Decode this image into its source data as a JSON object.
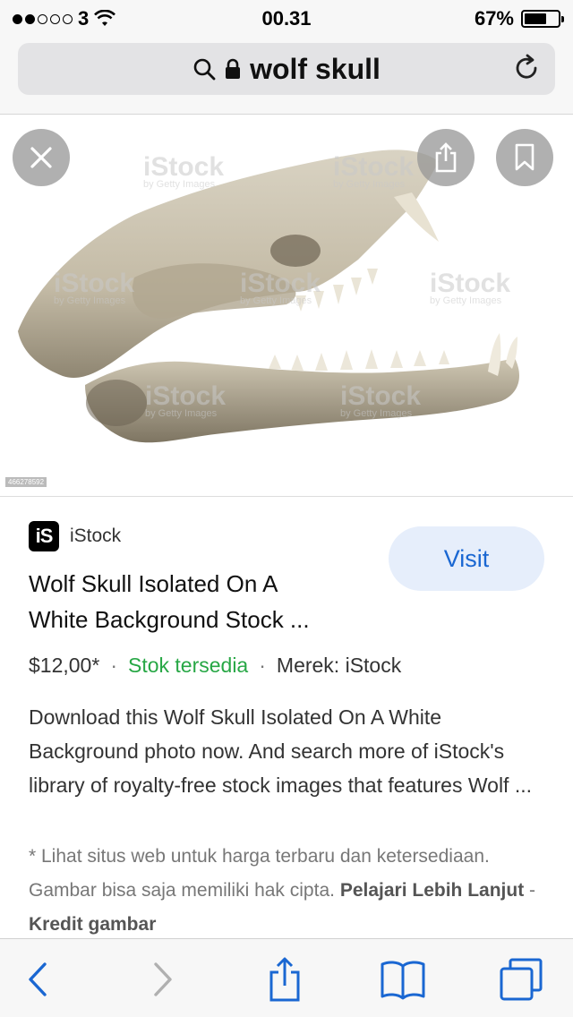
{
  "status_bar": {
    "carrier": "3",
    "time": "00.31",
    "battery_percent": "67%",
    "battery_level": 0.67
  },
  "url_bar": {
    "query": "wolf skull"
  },
  "image": {
    "watermark": "iStock",
    "watermark_sub": "by Getty Images",
    "image_id": "466278592"
  },
  "result": {
    "source_logo": "iS",
    "source": "iStock",
    "title_line1": "Wolf Skull Isolated On A",
    "title_line2": "White Background Stock ...",
    "visit_label": "Visit",
    "price": "$12,00*",
    "separator": "·",
    "availability": "Stok tersedia",
    "brand": "Merek: iStock",
    "description": "Download this Wolf Skull Isolated On A White Background photo now. And search more of iStock's library of royalty-free stock images that features Wolf ...",
    "note": "* Lihat situs web untuk harga terbaru dan ketersediaan. Gambar bisa saja memiliki hak cipta.",
    "learn_more": "Pelajari Lebih Lanjut",
    "dash": "-",
    "credit": "Kredit gambar"
  },
  "icons": [
    "close-icon",
    "share-icon",
    "bookmark-icon",
    "search-icon",
    "lock-icon",
    "reload-icon",
    "back-icon",
    "forward-icon",
    "book-icon",
    "tabs-icon"
  ],
  "colors": {
    "accent": "#1a67d2",
    "stock_green": "#27a745",
    "visit_bg": "#e6eefb"
  }
}
